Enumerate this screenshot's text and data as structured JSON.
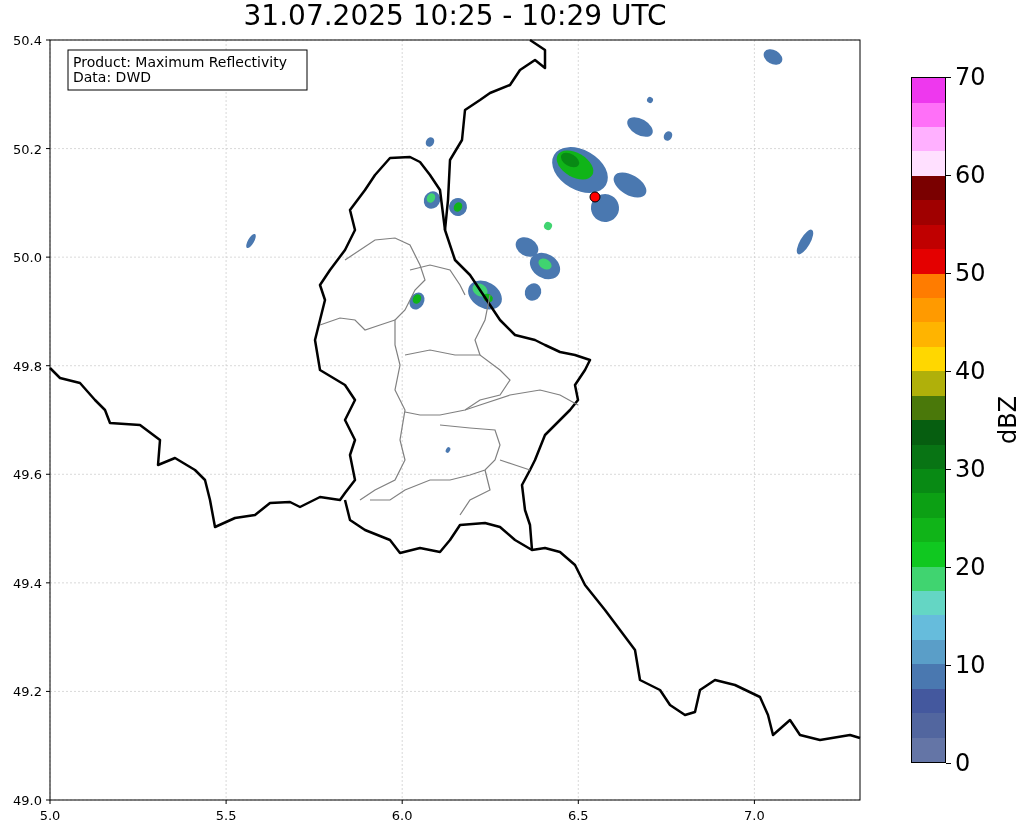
{
  "title": "31.07.2025 10:25 - 10:29 UTC",
  "map": {
    "legend": [
      "Product: Maximum Reflectivity",
      "Data: DWD"
    ],
    "xticks": [
      "5.0",
      "5.5",
      "6.0",
      "6.5",
      "7.0"
    ],
    "yticks": [
      "50.4",
      "50.2",
      "50.0",
      "49.8",
      "49.6",
      "49.4",
      "49.2",
      "49.0"
    ]
  },
  "colorbar": {
    "label": "dBZ",
    "ticks": [
      "70",
      "60",
      "50",
      "40",
      "30",
      "20",
      "10",
      "0"
    ],
    "segments": [
      {
        "color": "#6475a6"
      },
      {
        "color": "#52669f"
      },
      {
        "color": "#44589e"
      },
      {
        "color": "#4a78b0"
      },
      {
        "color": "#5a9ec8"
      },
      {
        "color": "#66bcdc"
      },
      {
        "color": "#64d6c4"
      },
      {
        "color": "#40d470"
      },
      {
        "color": "#10c820"
      },
      {
        "color": "#10b418"
      },
      {
        "color": "#0ca014"
      },
      {
        "color": "#088a14"
      },
      {
        "color": "#087414"
      },
      {
        "color": "#065e10"
      },
      {
        "color": "#4a780a"
      },
      {
        "color": "#b0b00a"
      },
      {
        "color": "#ffd700"
      },
      {
        "color": "#ffb400"
      },
      {
        "color": "#ff9a00"
      },
      {
        "color": "#ff7c00"
      },
      {
        "color": "#e40000"
      },
      {
        "color": "#c00000"
      },
      {
        "color": "#a00000"
      },
      {
        "color": "#7a0000"
      },
      {
        "color": "#ffe0ff"
      },
      {
        "color": "#ffb0ff"
      },
      {
        "color": "#ff70f8"
      },
      {
        "color": "#ee38ee"
      }
    ]
  }
}
